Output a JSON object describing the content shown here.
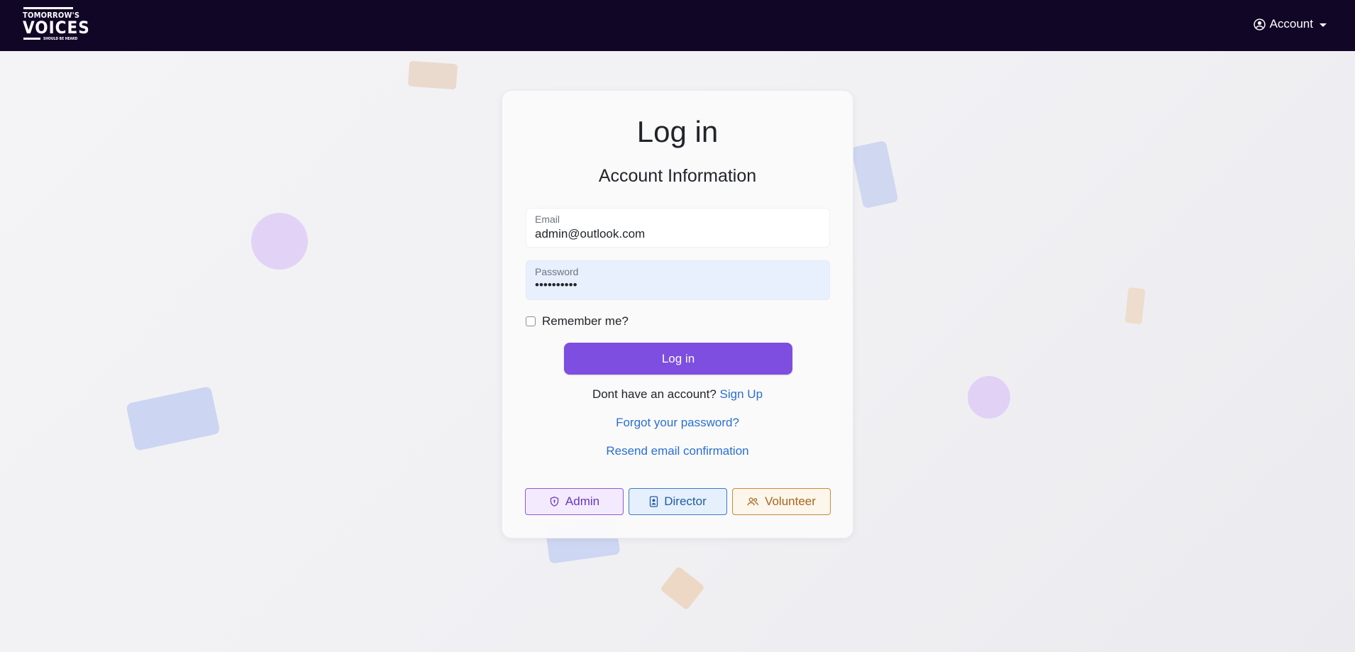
{
  "nav": {
    "logo": {
      "line1": "TOMORROW'S",
      "line2": "VOICES",
      "line3": "SHOULD BE HEARD"
    },
    "account_label": "Account"
  },
  "form": {
    "title": "Log in",
    "subtitle": "Account Information",
    "email": {
      "label": "Email",
      "value": "admin@outlook.com"
    },
    "password": {
      "label": "Password",
      "value": "••••••••••"
    },
    "remember_label": "Remember me?",
    "remember_checked": false,
    "submit_label": "Log in",
    "signup_prompt": "Dont have an account?",
    "signup_link": "Sign Up",
    "forgot_link": "Forgot your password?",
    "resend_link": "Resend email confirmation"
  },
  "demo_logins": [
    {
      "label": "Admin",
      "icon": "shield-icon"
    },
    {
      "label": "Director",
      "icon": "id-badge-icon"
    },
    {
      "label": "Volunteer",
      "icon": "people-icon"
    }
  ],
  "colors": {
    "navbar": "#120627",
    "primary": "#7e4ee0",
    "link": "#2a6fd1",
    "admin": "#8d5ad8",
    "director": "#3f79c9",
    "volunteer": "#c98a37"
  }
}
